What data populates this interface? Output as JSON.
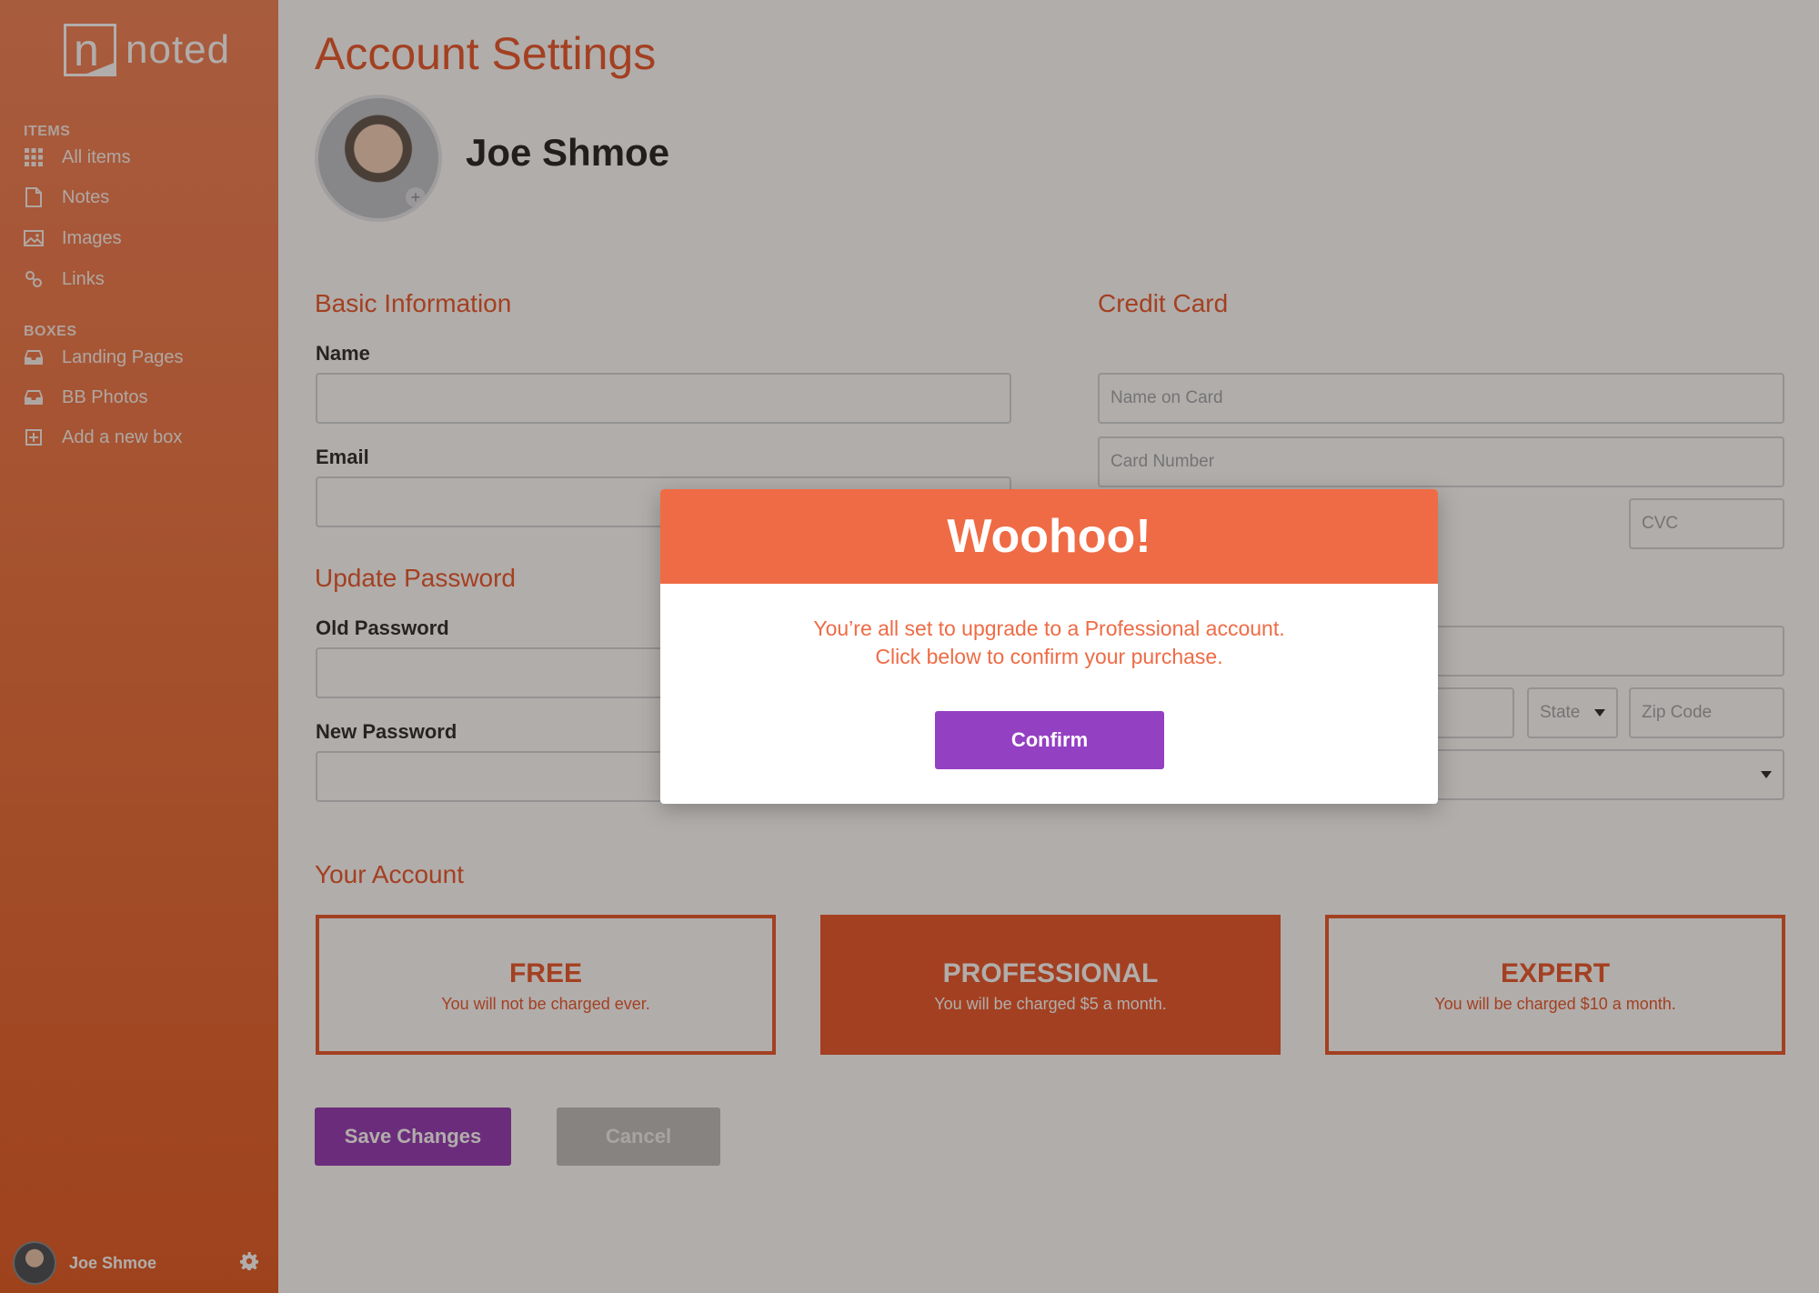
{
  "app": {
    "logo_text": "noted",
    "logo_letter": "n"
  },
  "sidebar": {
    "items_label": "ITEMS",
    "items": [
      {
        "label": "All items",
        "icon": "grid-icon"
      },
      {
        "label": "Notes",
        "icon": "document-icon"
      },
      {
        "label": "Images",
        "icon": "image-icon"
      },
      {
        "label": "Links",
        "icon": "link-icon"
      }
    ],
    "boxes_label": "BOXES",
    "boxes": [
      {
        "label": "Landing Pages",
        "icon": "inbox-icon"
      },
      {
        "label": "BB Photos",
        "icon": "inbox-icon"
      },
      {
        "label": "Add a new box",
        "icon": "plus-box-icon"
      }
    ],
    "user_name": "Joe Shmoe"
  },
  "page": {
    "title": "Account Settings",
    "profile_name": "Joe Shmoe"
  },
  "basic": {
    "title": "Basic Information",
    "name_label": "Name",
    "email_label": "Email"
  },
  "password": {
    "title": "Update Password",
    "old_label": "Old Password",
    "new_label": "New Password"
  },
  "card": {
    "title": "Credit Card",
    "name_placeholder": "Name on Card",
    "number_placeholder": "Card Number",
    "cvc_placeholder": "CVC",
    "state_label": "State",
    "zip_placeholder": "Zip Code"
  },
  "account": {
    "title": "Your Account",
    "plans": [
      {
        "name": "FREE",
        "desc": "You will not be charged ever.",
        "selected": false
      },
      {
        "name": "PROFESSIONAL",
        "desc": "You will be charged $5 a month.",
        "selected": true
      },
      {
        "name": "EXPERT",
        "desc": "You will be charged $10 a month.",
        "selected": false
      }
    ]
  },
  "actions": {
    "save_label": "Save Changes",
    "cancel_label": "Cancel"
  },
  "modal": {
    "title": "Woohoo!",
    "body": "You’re all set to upgrade to a Professional account. Click below to confirm your purchase.",
    "confirm_label": "Confirm"
  },
  "colors": {
    "brand_orange": "#e84a1a",
    "modal_header": "#ef6b45",
    "primary_purple": "#8b2ab0",
    "confirm_purple": "#9340c2"
  }
}
